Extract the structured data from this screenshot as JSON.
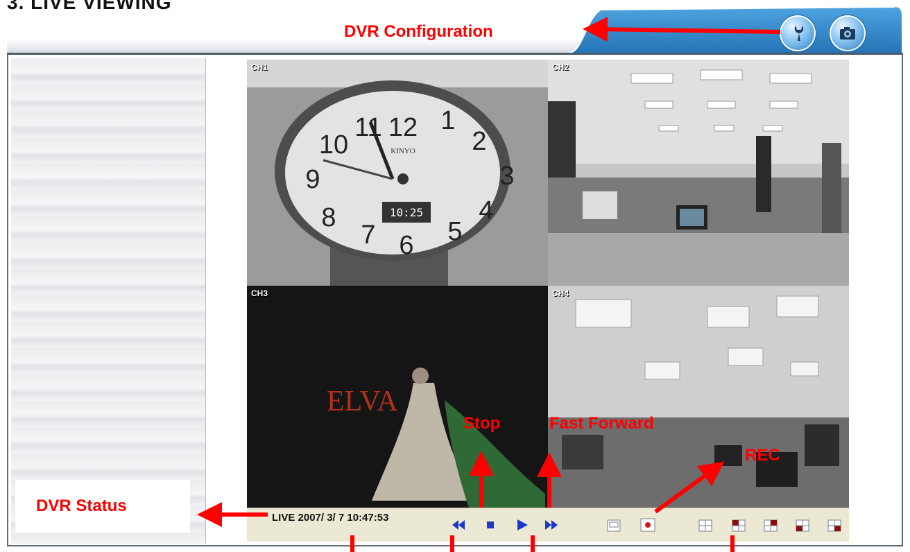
{
  "page": {
    "heading": "3. LIVE VIEWING"
  },
  "annotations": {
    "dvr_configuration": "DVR Configuration",
    "dvr_status": "DVR Status",
    "stop": "Stop",
    "fast_forward": "Fast Forward",
    "rec": "REC",
    "color": "#ff0000"
  },
  "header": {
    "buttons": [
      {
        "name": "config-button",
        "icon": "wrench-icon"
      },
      {
        "name": "snapshot-button",
        "icon": "camera-icon"
      }
    ],
    "tab_color": "#2b86c9"
  },
  "channels": [
    {
      "label": "CH1",
      "scene": "clock"
    },
    {
      "label": "CH2",
      "scene": "office"
    },
    {
      "label": "CH3",
      "scene": "stage"
    },
    {
      "label": "CH4",
      "scene": "office-wide"
    }
  ],
  "overlay_texts": {
    "clock_brand": "KINYO",
    "clock_digital": "10:25",
    "stage_text": "ELVA"
  },
  "status_bar": {
    "live_text": "LIVE 2007/ 3/ 7 10:47:53",
    "controls": [
      "rewind-icon",
      "stop-icon",
      "play-icon",
      "fast-forward-icon"
    ],
    "layouts": [
      "single-view-icon",
      "record-icon",
      "quad-view-icon",
      "quad-view-1-icon",
      "quad-view-2-icon",
      "quad-view-3-icon",
      "quad-view-4-icon"
    ]
  }
}
